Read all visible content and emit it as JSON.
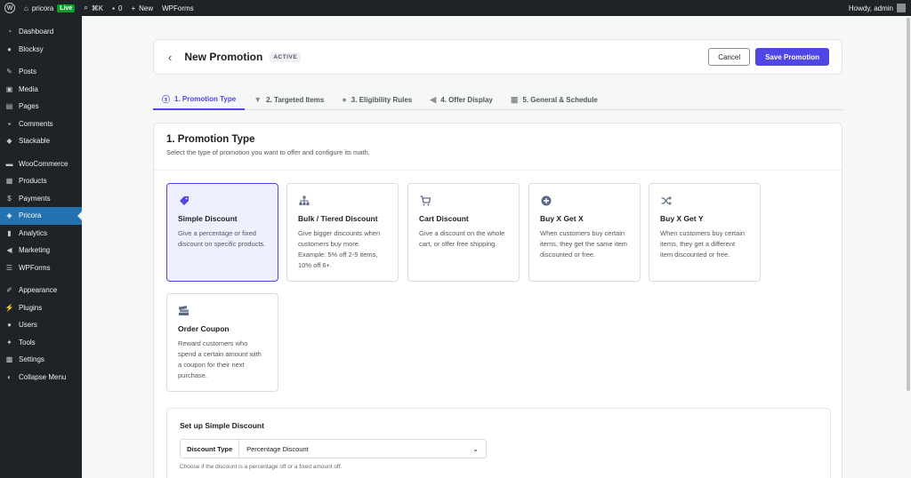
{
  "adminbar": {
    "site_name": "pricora",
    "live_badge": "Live",
    "shortcut": "⌘K",
    "comments_count": "0",
    "new_label": "New",
    "wpforms_label": "WPForms",
    "howdy": "Howdy, admin"
  },
  "sidebar": {
    "items": [
      {
        "label": "Dashboard",
        "icon": "dashboard-icon"
      },
      {
        "label": "Blocksy",
        "icon": "blocksy-icon"
      },
      {
        "label": "Posts",
        "icon": "pin-icon"
      },
      {
        "label": "Media",
        "icon": "media-icon"
      },
      {
        "label": "Pages",
        "icon": "page-icon"
      },
      {
        "label": "Comments",
        "icon": "comment-icon"
      },
      {
        "label": "Stackable",
        "icon": "stackable-icon"
      },
      {
        "label": "WooCommerce",
        "icon": "woo-icon"
      },
      {
        "label": "Products",
        "icon": "box-icon"
      },
      {
        "label": "Payments",
        "icon": "dollar-icon"
      },
      {
        "label": "Pricora",
        "icon": "pricora-icon"
      },
      {
        "label": "Analytics",
        "icon": "bar-chart-icon"
      },
      {
        "label": "Marketing",
        "icon": "megaphone-icon"
      },
      {
        "label": "WPForms",
        "icon": "form-icon"
      },
      {
        "label": "Appearance",
        "icon": "brush-icon"
      },
      {
        "label": "Plugins",
        "icon": "plug-icon"
      },
      {
        "label": "Users",
        "icon": "user-icon"
      },
      {
        "label": "Tools",
        "icon": "wrench-icon"
      },
      {
        "label": "Settings",
        "icon": "settings-icon"
      },
      {
        "label": "Collapse Menu",
        "icon": "collapse-icon"
      }
    ]
  },
  "header": {
    "title": "New Promotion",
    "status": "ACTIVE",
    "cancel_label": "Cancel",
    "save_label": "Save Promotion"
  },
  "tabs": [
    {
      "label": "1. Promotion Type"
    },
    {
      "label": "2. Targeted Items"
    },
    {
      "label": "3. Eligibility Rules"
    },
    {
      "label": "4. Offer Display"
    },
    {
      "label": "5. General & Schedule"
    }
  ],
  "section": {
    "title": "1. Promotion Type",
    "subtitle": "Select the type of promotion you want to offer and configure its math."
  },
  "types": [
    {
      "title": "Simple Discount",
      "desc": "Give a percentage or fixed discount on specific products.",
      "icon": "tag-icon"
    },
    {
      "title": "Bulk / Tiered Discount",
      "desc": "Give bigger discounts when customers buy more. Example: 5% off 2-5 items, 10% off 6+.",
      "icon": "hierarchy-icon"
    },
    {
      "title": "Cart Discount",
      "desc": "Give a discount on the whole cart, or offer free shipping.",
      "icon": "cart-icon"
    },
    {
      "title": "Buy X Get X",
      "desc": "When customers buy certain items, they get the same item discounted or free.",
      "icon": "plus-circle-icon"
    },
    {
      "title": "Buy X Get Y",
      "desc": "When customers buy certain items, they get a different item discounted or free.",
      "icon": "shuffle-icon"
    },
    {
      "title": "Order Coupon",
      "desc": "Reward customers who spend a certain amount with a coupon for their next purchase.",
      "icon": "coupon-icon"
    }
  ],
  "setup": {
    "title": "Set up Simple Discount",
    "discount_type_label": "Discount Type",
    "discount_type_value": "Percentage Discount",
    "help": "Choose if the discount is a percentage off or a fixed amount off."
  }
}
